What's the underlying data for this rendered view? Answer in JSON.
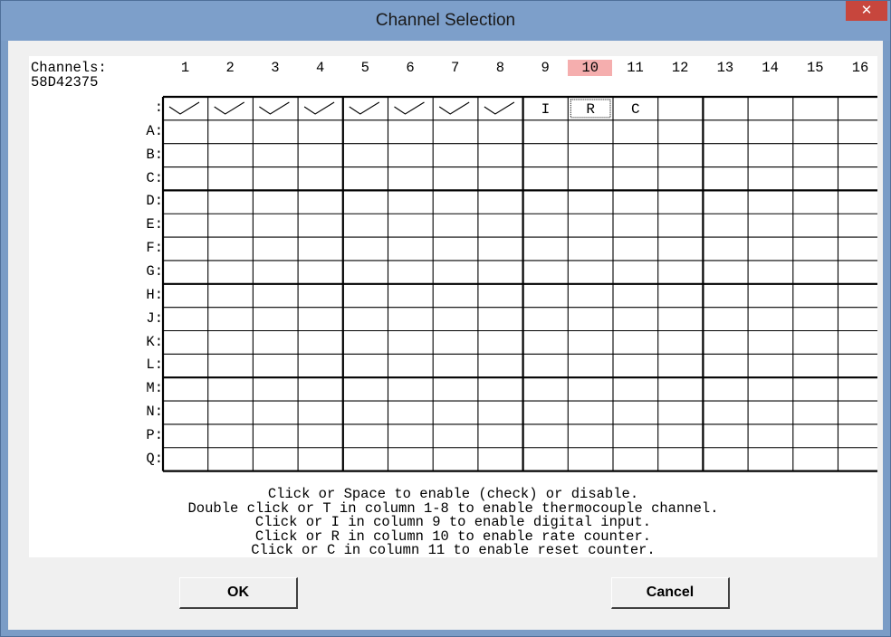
{
  "window": {
    "title": "Channel Selection",
    "close_symbol": "✕"
  },
  "grid": {
    "channels_label": "Channels:",
    "device_label": "58D42375",
    "device_sep": ":",
    "columns": [
      "1",
      "2",
      "3",
      "4",
      "5",
      "6",
      "7",
      "8",
      "9",
      "10",
      "11",
      "12",
      "13",
      "14",
      "15",
      "16"
    ],
    "highlighted_column": "10",
    "rows": [
      "A",
      "B",
      "C",
      "D",
      "E",
      "F",
      "G",
      "H",
      "J",
      "K",
      "L",
      "M",
      "N",
      "P",
      "Q"
    ],
    "device_row_states": [
      "check",
      "check",
      "check",
      "check",
      "check",
      "check",
      "check",
      "check",
      "I",
      "R",
      "C",
      "",
      "",
      "",
      "",
      ""
    ]
  },
  "instructions": [
    "Click or Space to enable (check) or disable.",
    "Double click or T in column 1-8 to enable thermocouple channel.",
    "Click or I in column 9 to enable digital input.",
    "Click or R in column 10 to enable rate counter.",
    "Click or C in column 11 to enable reset counter."
  ],
  "buttons": {
    "ok": "OK",
    "cancel": "Cancel"
  },
  "colors": {
    "highlight": "#f5aeae",
    "close": "#c7463d",
    "titlebar": "#7d9fca"
  }
}
